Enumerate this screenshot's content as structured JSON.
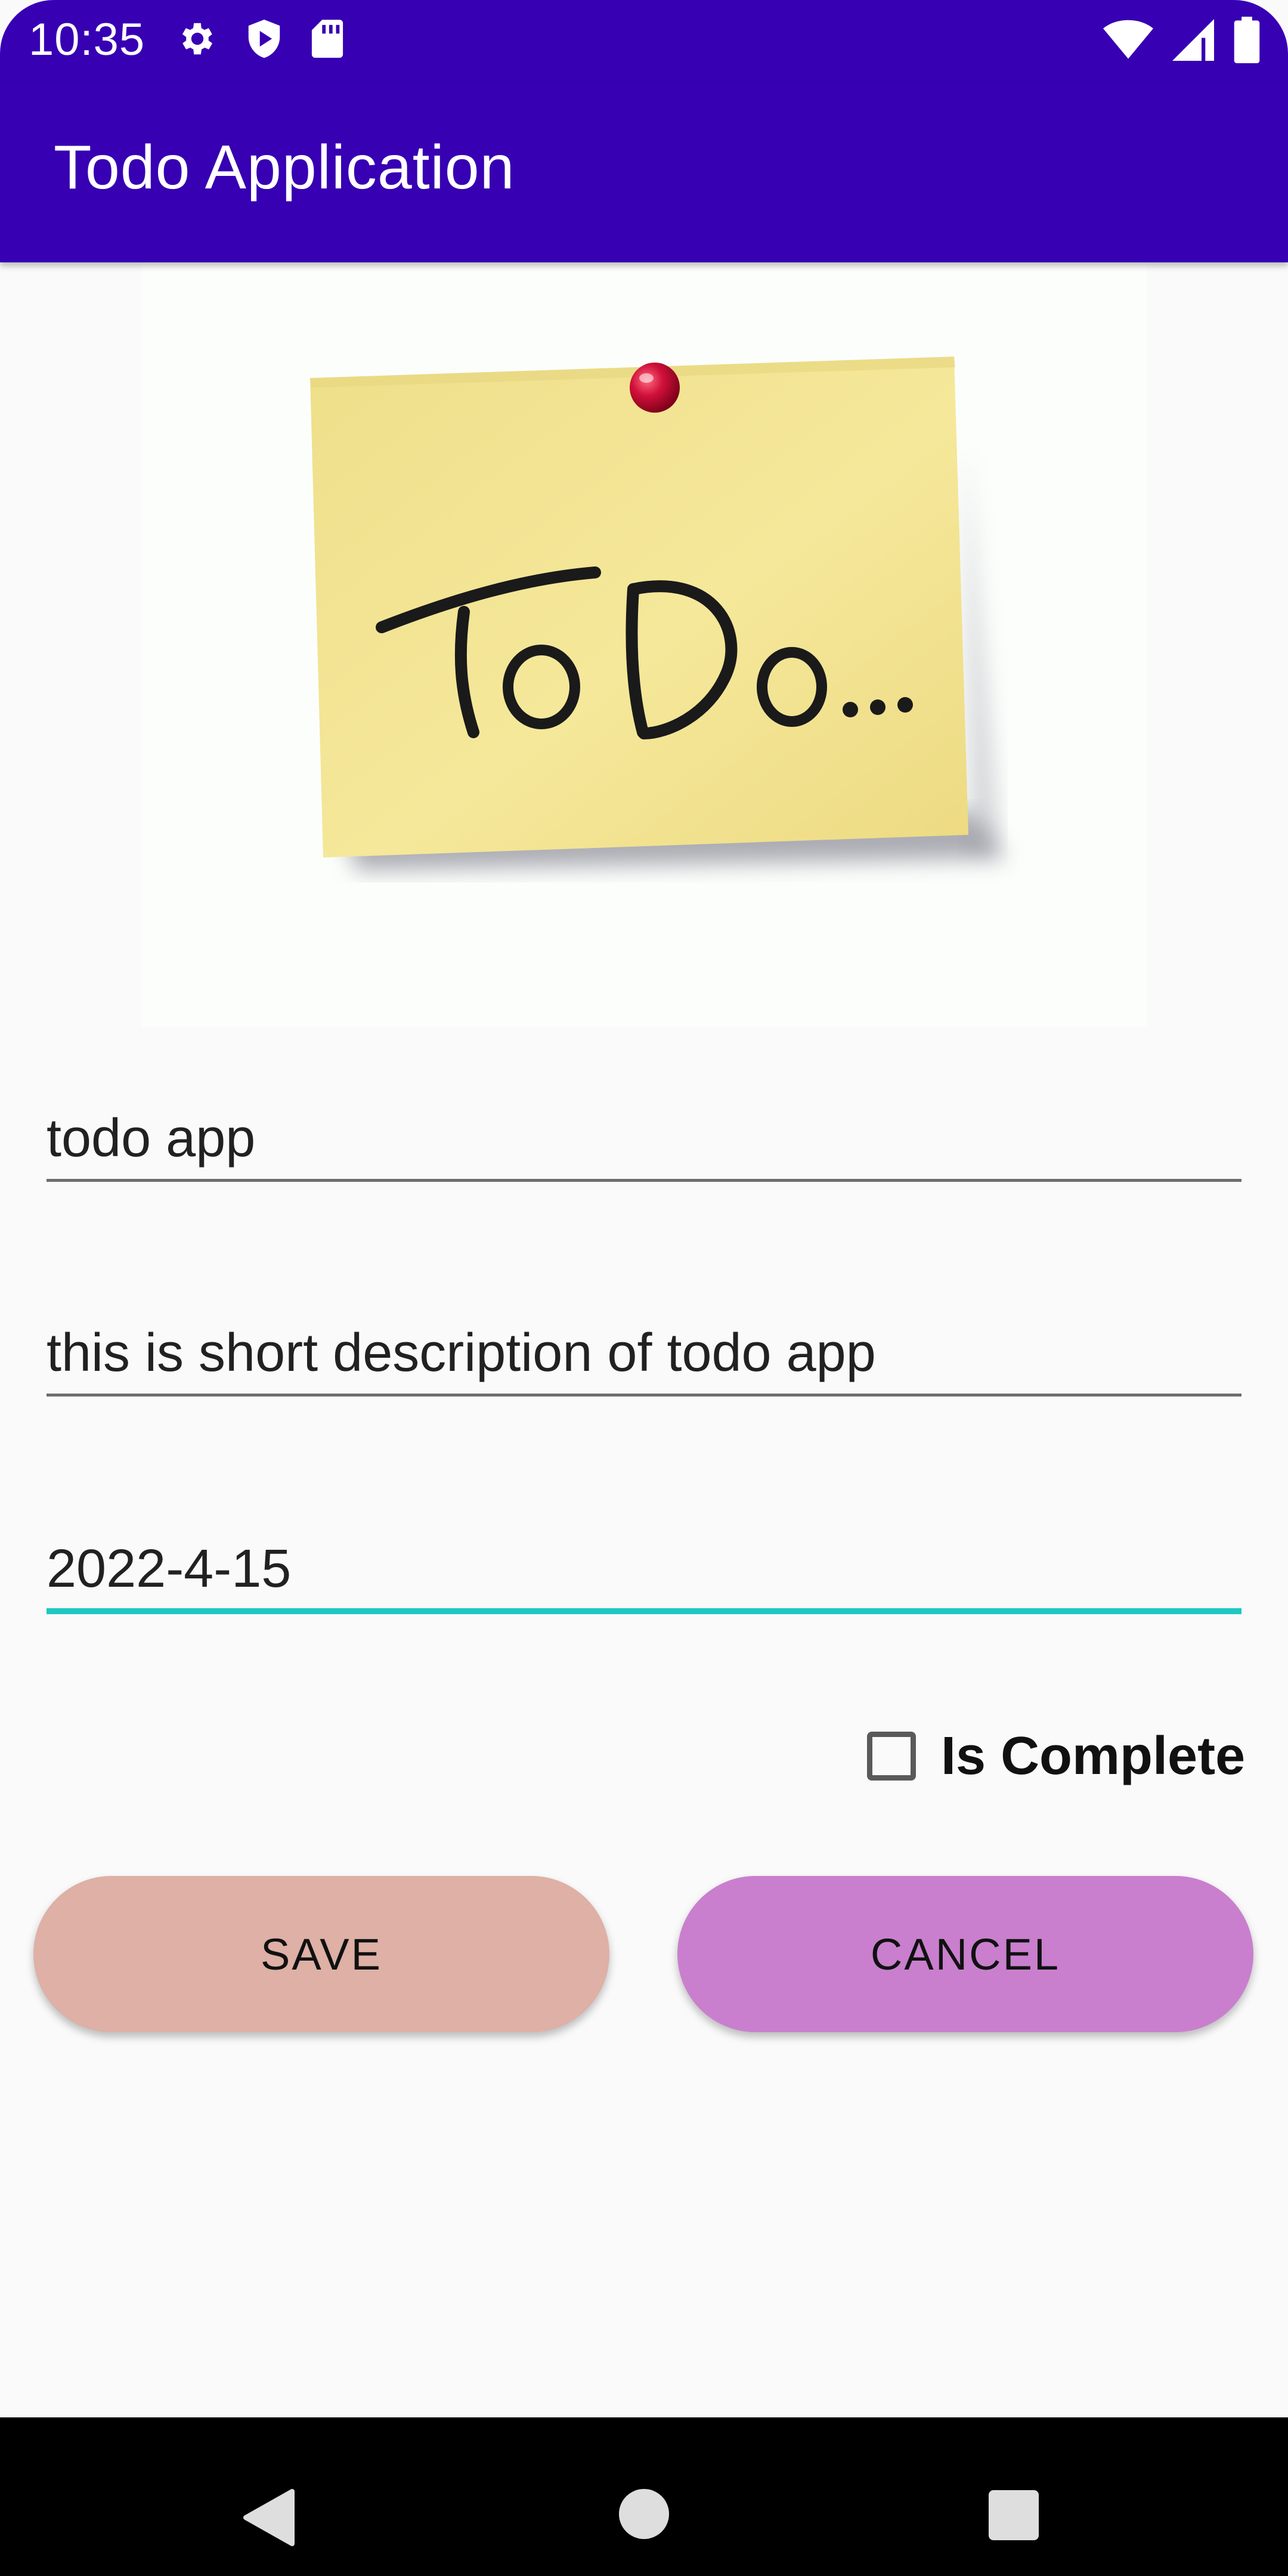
{
  "status_bar": {
    "time": "10:35",
    "left_icons": [
      "gear-icon",
      "shield-play-icon",
      "sd-card-icon"
    ],
    "right_icons": [
      "wifi-icon",
      "signal-icon",
      "battery-icon"
    ],
    "background": "#3700B3"
  },
  "app_bar": {
    "title": "Todo Application",
    "background": "#3700B3"
  },
  "form": {
    "title_value": "todo app",
    "description_value": "this is short description of todo app",
    "date_value": "2022-4-15",
    "active_underline_color": "#1DC8C0",
    "is_complete_label": "Is Complete",
    "is_complete_checked": false
  },
  "buttons": {
    "save_label": "SAVE",
    "save_color": "#DEB0A6",
    "cancel_label": "CANCEL",
    "cancel_color": "#C97FCE"
  },
  "nav_bar": {
    "icons": [
      "back-icon",
      "home-icon",
      "recents-icon"
    ]
  }
}
